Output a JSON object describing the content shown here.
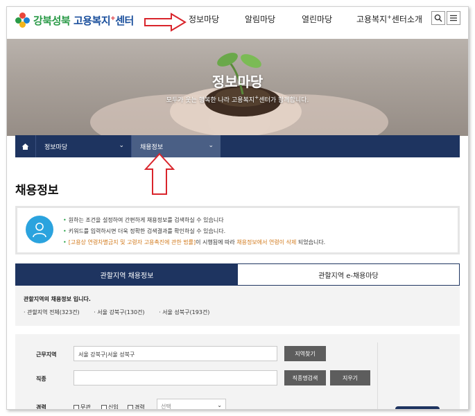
{
  "header": {
    "logo_part1": "강북성북",
    "logo_part2": "고용복지",
    "logo_plus": "+",
    "logo_part3": "센터",
    "nav": [
      {
        "label": "정보마당"
      },
      {
        "label": "알림마당"
      },
      {
        "label": "열린마당"
      },
      {
        "label_a": "고용복지",
        "plus": "+",
        "label_b": "센터소개"
      }
    ],
    "search_icon": "search-icon",
    "menu_icon": "hamburger-menu-icon"
  },
  "hero": {
    "title": "정보마당",
    "subtitle_a": "모두가 웃는 행복한 나라 고용복지",
    "subtitle_plus": "+",
    "subtitle_b": "센터가 함께합니다."
  },
  "breadcrumb": {
    "home_icon": "home-icon",
    "items": [
      {
        "label": "정보마당"
      },
      {
        "label": "채용정보"
      }
    ]
  },
  "page_title": "채용정보",
  "info": {
    "icon": "person-icon",
    "line1": "원하는 조건을 설정하여 간편하게 채용정보를 검색하실 수 있습니다",
    "line2": "키워드를 입력하시면 더욱 정확한 검색결과를 확인하실 수 있습니다.",
    "line3_a": "[고용상 연령차별금지 및 고령자 고용촉진에 관한 법률]",
    "line3_b": "이 시행됨에 따라 ",
    "line3_c": "채용정보에서 연령이 삭제",
    "line3_d": " 되었습니다."
  },
  "tabs": [
    {
      "label": "관할지역 채용정보",
      "active": true
    },
    {
      "label": "관할지역 e-채용마당",
      "active": false
    }
  ],
  "region": {
    "title": "관할지역의 채용정보 입니다.",
    "links": [
      {
        "label": "· 관할지역 전체(323건)"
      },
      {
        "label": "· 서울 강북구(130건)"
      },
      {
        "label": "· 서울 성북구(193건)"
      }
    ]
  },
  "form": {
    "location_label": "근무지역",
    "location_value": "서울 강북구|서울 성북구",
    "location_button": "지역찾기",
    "job_label": "직종",
    "job_value": "",
    "job_search_button": "직종명검색",
    "clear_button": "지우기",
    "career_label": "경력",
    "career_options": [
      {
        "label": "무관"
      },
      {
        "label": "신입"
      },
      {
        "label": "경력"
      }
    ],
    "career_select": "선택"
  },
  "colors": {
    "navy": "#1e3460",
    "logo_blue": "#1a4f9c",
    "logo_green": "#2a9a47",
    "arrow_red": "#d9242b",
    "info_icon_blue": "#2ba3de"
  }
}
